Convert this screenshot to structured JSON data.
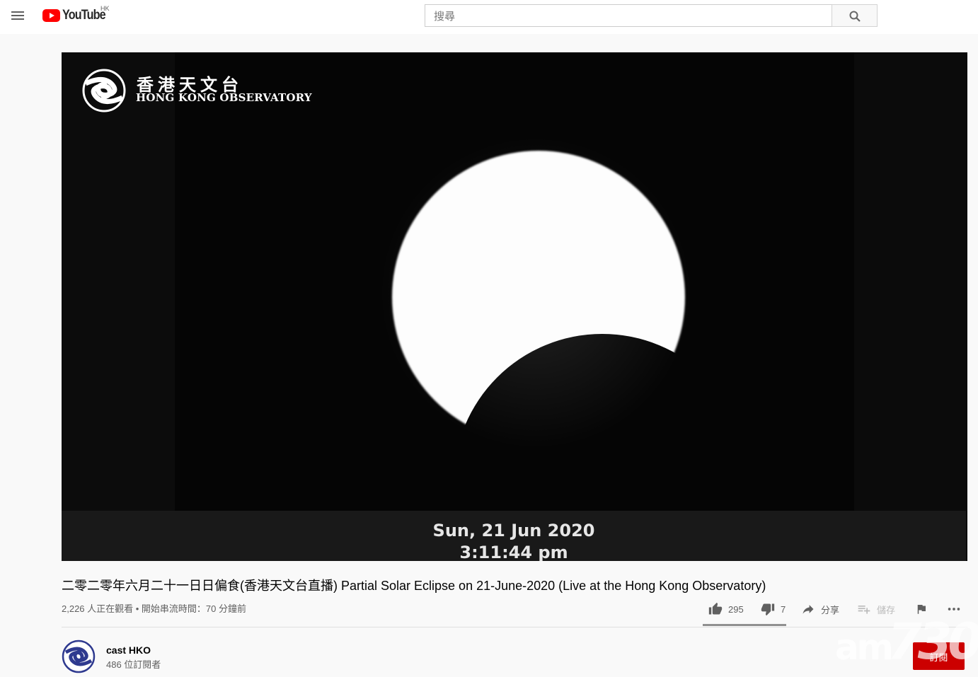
{
  "header": {
    "logo_text": "YouTube",
    "country_code": "HK",
    "search_placeholder": "搜尋"
  },
  "player": {
    "overlay_logo_zh": "香港天文台",
    "overlay_logo_en": "HONG KONG OBSERVATORY",
    "stamp_date": "Sun, 21 Jun 2020",
    "stamp_time": "3:11:44 pm"
  },
  "video": {
    "title": "二零二零年六月二十一日日偏食(香港天文台直播) Partial Solar Eclipse on 21-June-2020 (Live at the Hong Kong Observatory)",
    "meta": "2,226 人正在觀看 • 開始串流時間：70 分鐘前"
  },
  "actions": {
    "likes": "295",
    "dislikes": "7",
    "share_label": "分享",
    "save_label": "儲存"
  },
  "channel": {
    "name": "cast HKO",
    "subscribers": "486 位訂閱者",
    "subscribe_label": "訂閱"
  },
  "watermark": {
    "prefix": "am",
    "number": "730"
  },
  "colors": {
    "brand_red": "#ff0000",
    "subscribe_red": "#cc0000",
    "text_secondary": "#606060"
  }
}
